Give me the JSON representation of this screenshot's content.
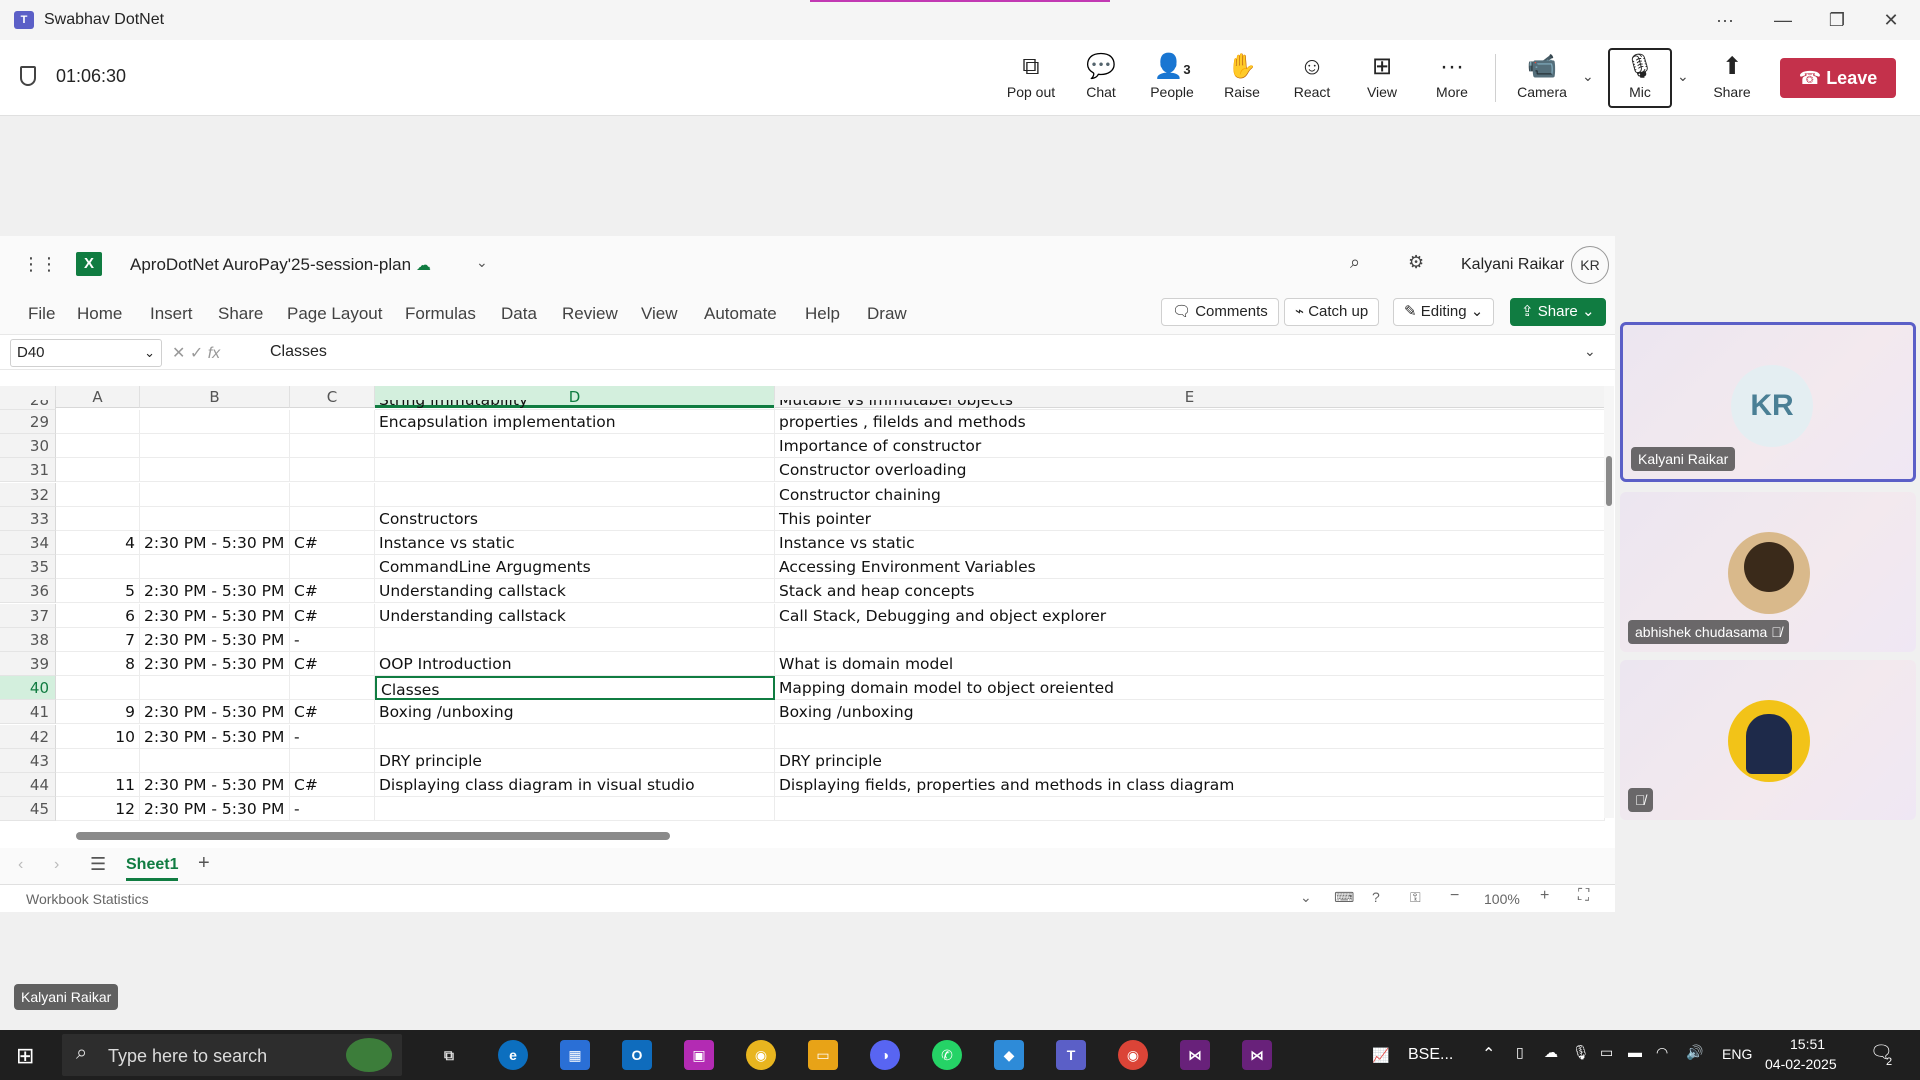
{
  "window": {
    "title": "Swabhav DotNet"
  },
  "meeting": {
    "timer": "01:06:30",
    "toolbar": [
      {
        "name": "pop-out-button",
        "icon": "pop-out-icon",
        "label": "Pop out"
      },
      {
        "name": "chat-button",
        "icon": "chat-icon",
        "label": "Chat"
      },
      {
        "name": "people-button",
        "icon": "people-icon",
        "label": "People",
        "count": "3"
      },
      {
        "name": "raise-button",
        "icon": "raise-hand-icon",
        "label": "Raise"
      },
      {
        "name": "react-button",
        "icon": "smiley-icon",
        "label": "React"
      },
      {
        "name": "view-button",
        "icon": "grid-icon",
        "label": "View"
      },
      {
        "name": "more-button",
        "icon": "ellipsis-icon",
        "label": "More"
      }
    ],
    "camera_label": "Camera",
    "mic_label": "Mic",
    "share_label": "Share",
    "leave_label": "Leave"
  },
  "excel": {
    "workbook_title": "AproDotNet AuroPay'25-session-plan",
    "user_name": "Kalyani Raikar",
    "user_initials": "KR",
    "menu": [
      "File",
      "Home",
      "Insert",
      "Share",
      "Page Layout",
      "Formulas",
      "Data",
      "Review",
      "View",
      "Automate",
      "Help",
      "Draw"
    ],
    "comments_label": "Comments",
    "catchup_label": "Catch up",
    "editing_label": "Editing",
    "share_label": "Share",
    "name_box": "D40",
    "formula_value": "Classes",
    "columns": [
      "A",
      "B",
      "C",
      "D",
      "E"
    ],
    "rows": [
      {
        "n": "29",
        "a": "",
        "b": "",
        "c": "",
        "d": "Encapsulation implementation",
        "e": "properties , filelds and methods"
      },
      {
        "n": "30",
        "a": "",
        "b": "",
        "c": "",
        "d": "",
        "e": "Importance of constructor"
      },
      {
        "n": "31",
        "a": "",
        "b": "",
        "c": "",
        "d": "",
        "e": "Constructor overloading"
      },
      {
        "n": "32",
        "a": "",
        "b": "",
        "c": "",
        "d": "",
        "e": "Constructor chaining"
      },
      {
        "n": "33",
        "a": "",
        "b": "",
        "c": "",
        "d": "Constructors",
        "e": "This pointer"
      },
      {
        "n": "34",
        "a": "4",
        "b": "2:30 PM - 5:30 PM",
        "c": "C#",
        "d": "Instance vs static",
        "e": "Instance vs static"
      },
      {
        "n": "35",
        "a": "",
        "b": "",
        "c": "",
        "d": "CommandLine Argugments",
        "e": "Accessing Environment Variables"
      },
      {
        "n": "36",
        "a": "5",
        "b": "2:30 PM - 5:30 PM",
        "c": "C#",
        "d": "Understanding callstack",
        "e": "Stack and heap concepts"
      },
      {
        "n": "37",
        "a": "6",
        "b": "2:30 PM - 5:30 PM",
        "c": "C#",
        "d": "Understanding callstack",
        "e": "Call Stack, Debugging and object explorer"
      },
      {
        "n": "38",
        "a": "7",
        "b": "2:30 PM - 5:30 PM",
        "c": "-",
        "d": "",
        "e": ""
      },
      {
        "n": "39",
        "a": "8",
        "b": "2:30 PM - 5:30 PM",
        "c": "C#",
        "d": "OOP Introduction",
        "e": "What is domain model"
      },
      {
        "n": "40",
        "a": "",
        "b": "",
        "c": "",
        "d": "Classes",
        "e": "Mapping domain model to object oreiented"
      },
      {
        "n": "41",
        "a": "9",
        "b": "2:30 PM - 5:30 PM",
        "c": "C#",
        "d": "Boxing /unboxing",
        "e": "Boxing /unboxing"
      },
      {
        "n": "42",
        "a": "10",
        "b": "2:30 PM - 5:30 PM",
        "c": "-",
        "d": "",
        "e": ""
      },
      {
        "n": "43",
        "a": "",
        "b": "",
        "c": "",
        "d": "DRY principle",
        "e": "DRY principle"
      },
      {
        "n": "44",
        "a": "11",
        "b": "2:30 PM - 5:30 PM",
        "c": "C#",
        "d": "Displaying class diagram in visual studio",
        "e": "Displaying fields, properties and methods in class diagram"
      },
      {
        "n": "45",
        "a": "12",
        "b": "2:30 PM - 5:30 PM",
        "c": "-",
        "d": "",
        "e": ""
      }
    ],
    "partial_row": {
      "n": "28",
      "d": "String immutability",
      "e": "Mutable vs immutabel objects"
    },
    "sheet_tab": "Sheet1",
    "status_text": "Workbook Statistics",
    "zoom": "100%"
  },
  "participants": [
    {
      "name": "Kalyani Raikar",
      "initials": "KR",
      "speaking": true
    },
    {
      "name": "abhishek chudasama",
      "muted": true
    },
    {
      "name": "",
      "muted": true
    }
  ],
  "presenter_label": "Kalyani Raikar",
  "taskbar": {
    "search_placeholder": "Type here to search",
    "stock_label": "BSE...",
    "language": "ENG",
    "time": "15:51",
    "date": "04-02-2025",
    "notification_count": "2"
  }
}
